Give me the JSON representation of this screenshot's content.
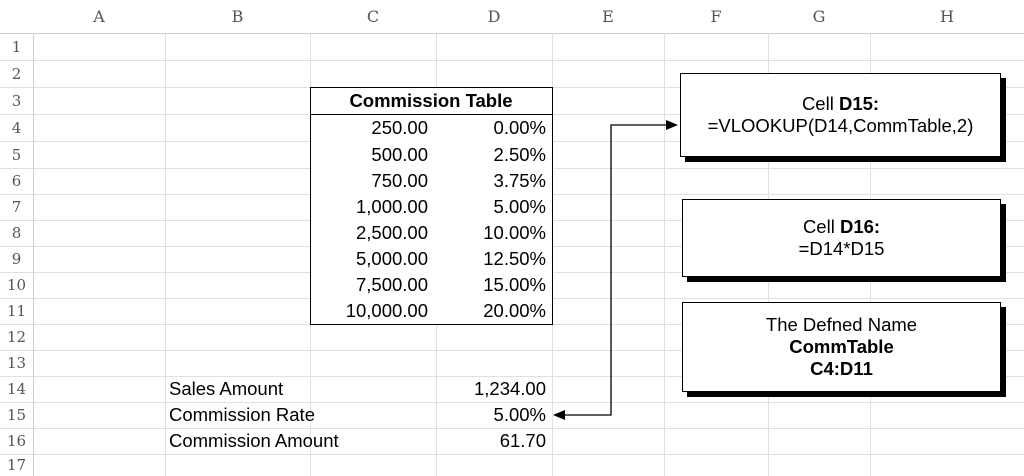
{
  "columns": [
    "A",
    "B",
    "C",
    "D",
    "E",
    "F",
    "G",
    "H"
  ],
  "rows": [
    "1",
    "2",
    "3",
    "4",
    "5",
    "6",
    "7",
    "8",
    "9",
    "10",
    "11",
    "12",
    "13",
    "14",
    "15",
    "16",
    "17"
  ],
  "commission_table": {
    "title": "Commission Table",
    "sales": [
      "250.00",
      "500.00",
      "750.00",
      "1,000.00",
      "2,500.00",
      "5,000.00",
      "7,500.00",
      "10,000.00"
    ],
    "rates": [
      "0.00%",
      "2.50%",
      "3.75%",
      "5.00%",
      "10.00%",
      "12.50%",
      "15.00%",
      "20.00%"
    ]
  },
  "summary": {
    "sales_label": "Sales Amount",
    "sales_value": "1,234.00",
    "rate_label": "Commission Rate",
    "rate_value": "5.00%",
    "amount_label": "Commission Amount",
    "amount_value": "61.70"
  },
  "callouts": {
    "d15_prefix": "Cell ",
    "d15_ref": "D15:",
    "d15_formula": "=VLOOKUP(D14,CommTable,2)",
    "d16_prefix": "Cell ",
    "d16_ref": "D16:",
    "d16_formula": "=D14*D15",
    "name_line1": "The Defned Name",
    "name_line2": "CommTable",
    "name_line3": "C4:D11"
  }
}
